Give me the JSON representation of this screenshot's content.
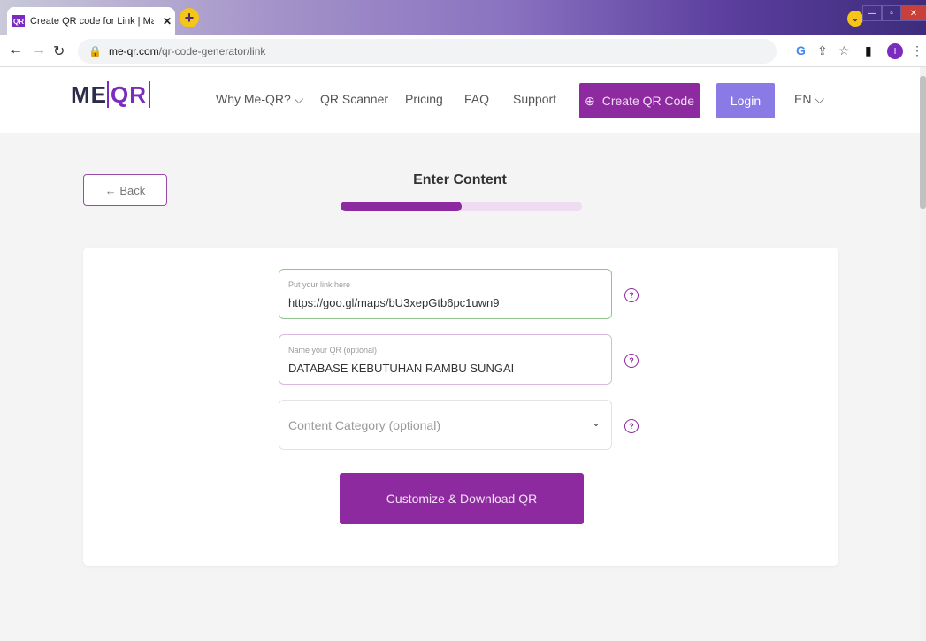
{
  "browser": {
    "tab_title": "Create QR code for Link | Make yc",
    "tab_favicon": "QR",
    "address_domain": "me-qr.com",
    "address_path": "/qr-code-generator/link",
    "profile_initial": "I"
  },
  "header": {
    "logo_me": "ME",
    "logo_qr": "QR",
    "menu": [
      "Why Me-QR? ⌵",
      "QR Scanner",
      "Pricing",
      "FAQ",
      "Support"
    ],
    "create_label": "Create QR Code",
    "login_label": "Login",
    "language": "EN ⌵"
  },
  "main": {
    "back_label": "← Back",
    "step_title": "Enter Content",
    "progress_fraction": 0.5
  },
  "form": {
    "link_placeholder": "Put your link here",
    "link_value": "https://goo.gl/maps/bU3xepGtb6pc1uwn9",
    "name_placeholder": "Name your QR (optional)",
    "name_value": "DATABASE KEBUTUHAN RAMBU SUNGAI",
    "category_placeholder": "Content Category (optional)",
    "submit_label": "Customize & Download QR"
  },
  "colors": {
    "brand_purple": "#8e2a9f",
    "login_blue": "#8a7ae6"
  }
}
